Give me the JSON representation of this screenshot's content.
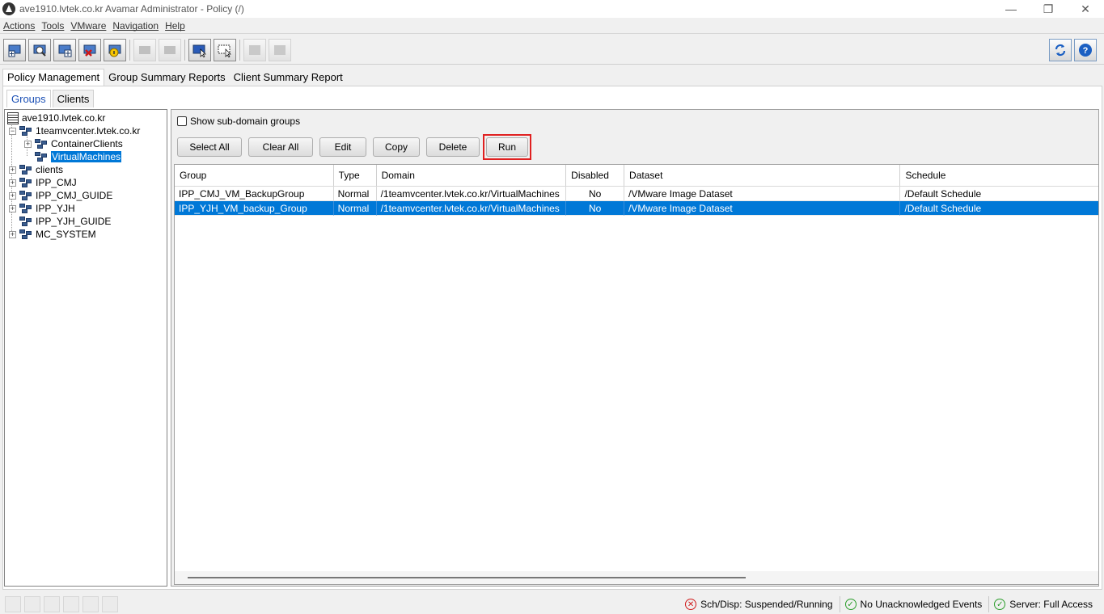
{
  "window": {
    "title": "ave1910.lvtek.co.kr Avamar Administrator - Policy (/)",
    "minimize": "—",
    "maximize": "❐",
    "close": "✕"
  },
  "menu": [
    "Actions",
    "Tools",
    "VMware",
    "Navigation",
    "Help"
  ],
  "toolbar": {
    "buttons": [
      "policy-new-icon",
      "policy-search-icon",
      "policy-add-icon",
      "policy-delete-icon",
      "policy-info-icon",
      "disabled-icon-1",
      "disabled-icon-2",
      "select-view-icon",
      "select-list-icon",
      "disabled-icon-3",
      "disabled-icon-4"
    ],
    "refresh_icon": "refresh-icon",
    "help_icon": "help-icon"
  },
  "main_tabs": [
    "Policy Management",
    "Group Summary Reports",
    "Client Summary Report"
  ],
  "sub_tabs": [
    "Groups",
    "Clients"
  ],
  "tree": {
    "root": "ave1910.lvtek.co.kr",
    "nodes": [
      {
        "label": "1teamvcenter.lvtek.co.kr"
      },
      {
        "label": "ContainerClients"
      },
      {
        "label": "VirtualMachines"
      },
      {
        "label": "clients"
      },
      {
        "label": "IPP_CMJ"
      },
      {
        "label": "IPP_CMJ_GUIDE"
      },
      {
        "label": "IPP_YJH"
      },
      {
        "label": "IPP_YJH_GUIDE"
      },
      {
        "label": "MC_SYSTEM"
      }
    ]
  },
  "options": {
    "show_subdomain_label": "Show sub-domain groups"
  },
  "actions": {
    "select_all": "Select All",
    "clear_all": "Clear All",
    "edit": "Edit",
    "copy": "Copy",
    "delete": "Delete",
    "run": "Run"
  },
  "table": {
    "columns": [
      "Group",
      "Type",
      "Domain",
      "Disabled",
      "Dataset",
      "Schedule"
    ],
    "rows": [
      [
        "IPP_CMJ_VM_BackupGroup",
        "Normal",
        "/1teamvcenter.lvtek.co.kr/VirtualMachines",
        "No",
        "/VMware Image Dataset",
        "/Default Schedule"
      ],
      [
        "IPP_YJH_VM_backup_Group",
        "Normal",
        "/1teamvcenter.lvtek.co.kr/VirtualMachines",
        "No",
        "/VMware Image Dataset",
        "/Default Schedule"
      ]
    ]
  },
  "status": {
    "sched": "Sch/Disp: Suspended/Running",
    "events": "No Unacknowledged Events",
    "server": "Server: Full Access"
  },
  "colors": {
    "selection": "#0078d7",
    "highlight_border": "#e02020"
  }
}
